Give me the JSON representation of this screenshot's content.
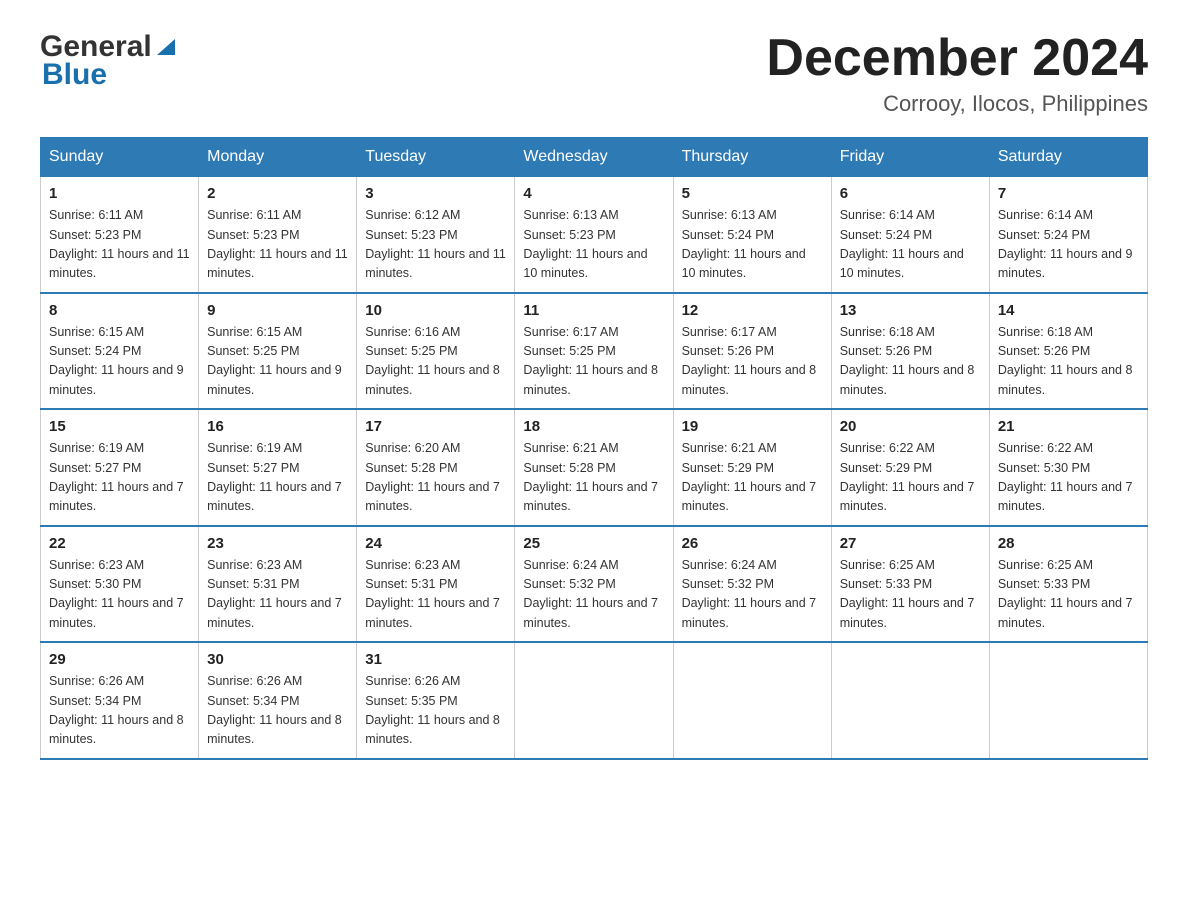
{
  "logo": {
    "general": "General",
    "blue": "Blue",
    "triangle": "▶"
  },
  "title": {
    "month": "December 2024",
    "location": "Corrooy, Ilocos, Philippines"
  },
  "header_days": [
    "Sunday",
    "Monday",
    "Tuesday",
    "Wednesday",
    "Thursday",
    "Friday",
    "Saturday"
  ],
  "weeks": [
    [
      {
        "day": "1",
        "sunrise": "6:11 AM",
        "sunset": "5:23 PM",
        "daylight": "11 hours and 11 minutes."
      },
      {
        "day": "2",
        "sunrise": "6:11 AM",
        "sunset": "5:23 PM",
        "daylight": "11 hours and 11 minutes."
      },
      {
        "day": "3",
        "sunrise": "6:12 AM",
        "sunset": "5:23 PM",
        "daylight": "11 hours and 11 minutes."
      },
      {
        "day": "4",
        "sunrise": "6:13 AM",
        "sunset": "5:23 PM",
        "daylight": "11 hours and 10 minutes."
      },
      {
        "day": "5",
        "sunrise": "6:13 AM",
        "sunset": "5:24 PM",
        "daylight": "11 hours and 10 minutes."
      },
      {
        "day": "6",
        "sunrise": "6:14 AM",
        "sunset": "5:24 PM",
        "daylight": "11 hours and 10 minutes."
      },
      {
        "day": "7",
        "sunrise": "6:14 AM",
        "sunset": "5:24 PM",
        "daylight": "11 hours and 9 minutes."
      }
    ],
    [
      {
        "day": "8",
        "sunrise": "6:15 AM",
        "sunset": "5:24 PM",
        "daylight": "11 hours and 9 minutes."
      },
      {
        "day": "9",
        "sunrise": "6:15 AM",
        "sunset": "5:25 PM",
        "daylight": "11 hours and 9 minutes."
      },
      {
        "day": "10",
        "sunrise": "6:16 AM",
        "sunset": "5:25 PM",
        "daylight": "11 hours and 8 minutes."
      },
      {
        "day": "11",
        "sunrise": "6:17 AM",
        "sunset": "5:25 PM",
        "daylight": "11 hours and 8 minutes."
      },
      {
        "day": "12",
        "sunrise": "6:17 AM",
        "sunset": "5:26 PM",
        "daylight": "11 hours and 8 minutes."
      },
      {
        "day": "13",
        "sunrise": "6:18 AM",
        "sunset": "5:26 PM",
        "daylight": "11 hours and 8 minutes."
      },
      {
        "day": "14",
        "sunrise": "6:18 AM",
        "sunset": "5:26 PM",
        "daylight": "11 hours and 8 minutes."
      }
    ],
    [
      {
        "day": "15",
        "sunrise": "6:19 AM",
        "sunset": "5:27 PM",
        "daylight": "11 hours and 7 minutes."
      },
      {
        "day": "16",
        "sunrise": "6:19 AM",
        "sunset": "5:27 PM",
        "daylight": "11 hours and 7 minutes."
      },
      {
        "day": "17",
        "sunrise": "6:20 AM",
        "sunset": "5:28 PM",
        "daylight": "11 hours and 7 minutes."
      },
      {
        "day": "18",
        "sunrise": "6:21 AM",
        "sunset": "5:28 PM",
        "daylight": "11 hours and 7 minutes."
      },
      {
        "day": "19",
        "sunrise": "6:21 AM",
        "sunset": "5:29 PM",
        "daylight": "11 hours and 7 minutes."
      },
      {
        "day": "20",
        "sunrise": "6:22 AM",
        "sunset": "5:29 PM",
        "daylight": "11 hours and 7 minutes."
      },
      {
        "day": "21",
        "sunrise": "6:22 AM",
        "sunset": "5:30 PM",
        "daylight": "11 hours and 7 minutes."
      }
    ],
    [
      {
        "day": "22",
        "sunrise": "6:23 AM",
        "sunset": "5:30 PM",
        "daylight": "11 hours and 7 minutes."
      },
      {
        "day": "23",
        "sunrise": "6:23 AM",
        "sunset": "5:31 PM",
        "daylight": "11 hours and 7 minutes."
      },
      {
        "day": "24",
        "sunrise": "6:23 AM",
        "sunset": "5:31 PM",
        "daylight": "11 hours and 7 minutes."
      },
      {
        "day": "25",
        "sunrise": "6:24 AM",
        "sunset": "5:32 PM",
        "daylight": "11 hours and 7 minutes."
      },
      {
        "day": "26",
        "sunrise": "6:24 AM",
        "sunset": "5:32 PM",
        "daylight": "11 hours and 7 minutes."
      },
      {
        "day": "27",
        "sunrise": "6:25 AM",
        "sunset": "5:33 PM",
        "daylight": "11 hours and 7 minutes."
      },
      {
        "day": "28",
        "sunrise": "6:25 AM",
        "sunset": "5:33 PM",
        "daylight": "11 hours and 7 minutes."
      }
    ],
    [
      {
        "day": "29",
        "sunrise": "6:26 AM",
        "sunset": "5:34 PM",
        "daylight": "11 hours and 8 minutes."
      },
      {
        "day": "30",
        "sunrise": "6:26 AM",
        "sunset": "5:34 PM",
        "daylight": "11 hours and 8 minutes."
      },
      {
        "day": "31",
        "sunrise": "6:26 AM",
        "sunset": "5:35 PM",
        "daylight": "11 hours and 8 minutes."
      },
      null,
      null,
      null,
      null
    ]
  ]
}
